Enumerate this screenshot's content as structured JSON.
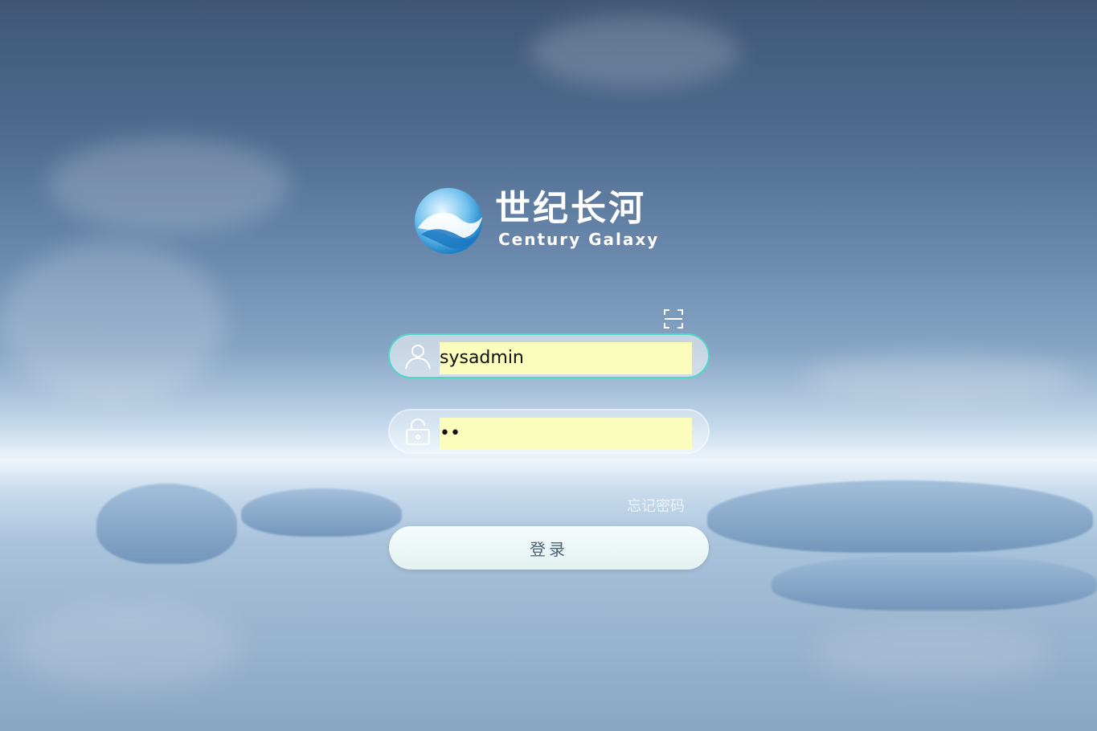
{
  "brand": {
    "name_cn": "世纪长河",
    "name_en": "Century Galaxy"
  },
  "login_form": {
    "username_value": "sysadmin",
    "password_value": "••",
    "forgot_password_label": "忘记密码",
    "submit_label": "登录"
  },
  "colors": {
    "active_border": "#4fd8c4",
    "autofill_bg": "#fbfdbc"
  },
  "icons": {
    "qr": "qr-scan-icon",
    "user": "user-icon",
    "lock": "lock-icon"
  }
}
